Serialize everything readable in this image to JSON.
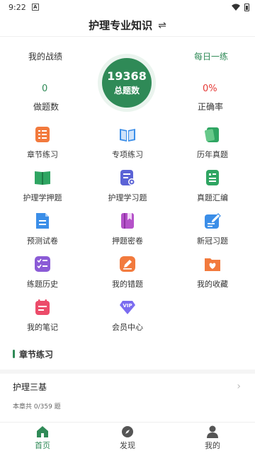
{
  "status": {
    "time": "9:22",
    "notif": "A"
  },
  "header": {
    "title": "护理专业知识",
    "switch_icon": "⇌"
  },
  "stats": {
    "record_label": "我的战绩",
    "daily_label": "每日一练",
    "total_count": "19368",
    "total_label": "总题数",
    "done_count": "0",
    "done_label": "做题数",
    "accuracy": "0%",
    "accuracy_label": "正确率",
    "accent": "#2f8a57",
    "accuracy_color": "#e53935"
  },
  "menu": [
    {
      "label": "章节练习",
      "icon": "chapter-list-icon"
    },
    {
      "label": "专项练习",
      "icon": "open-book-icon"
    },
    {
      "label": "历年真题",
      "icon": "notebook-icon"
    },
    {
      "label": "护理学押题",
      "icon": "green-book-icon"
    },
    {
      "label": "护理学习题",
      "icon": "exercise-icon"
    },
    {
      "label": "真题汇编",
      "icon": "compilation-icon"
    },
    {
      "label": "预测试卷",
      "icon": "document-icon"
    },
    {
      "label": "押题密卷",
      "icon": "bookmark-book-icon"
    },
    {
      "label": "新冠习题",
      "icon": "edit-note-icon"
    },
    {
      "label": "练题历史",
      "icon": "checklist-icon"
    },
    {
      "label": "我的错题",
      "icon": "pencil-icon"
    },
    {
      "label": "我的收藏",
      "icon": "heart-folder-icon"
    },
    {
      "label": "我的笔记",
      "icon": "calendar-note-icon"
    },
    {
      "label": "会员中心",
      "icon": "vip-diamond-icon"
    }
  ],
  "section": {
    "title": "章节练习"
  },
  "chapter": {
    "name": "护理三基",
    "count": "本章共 0/359 题"
  },
  "nav": [
    {
      "label": "首页",
      "icon": "home-icon"
    },
    {
      "label": "发现",
      "icon": "compass-icon"
    },
    {
      "label": "我的",
      "icon": "person-icon"
    }
  ]
}
